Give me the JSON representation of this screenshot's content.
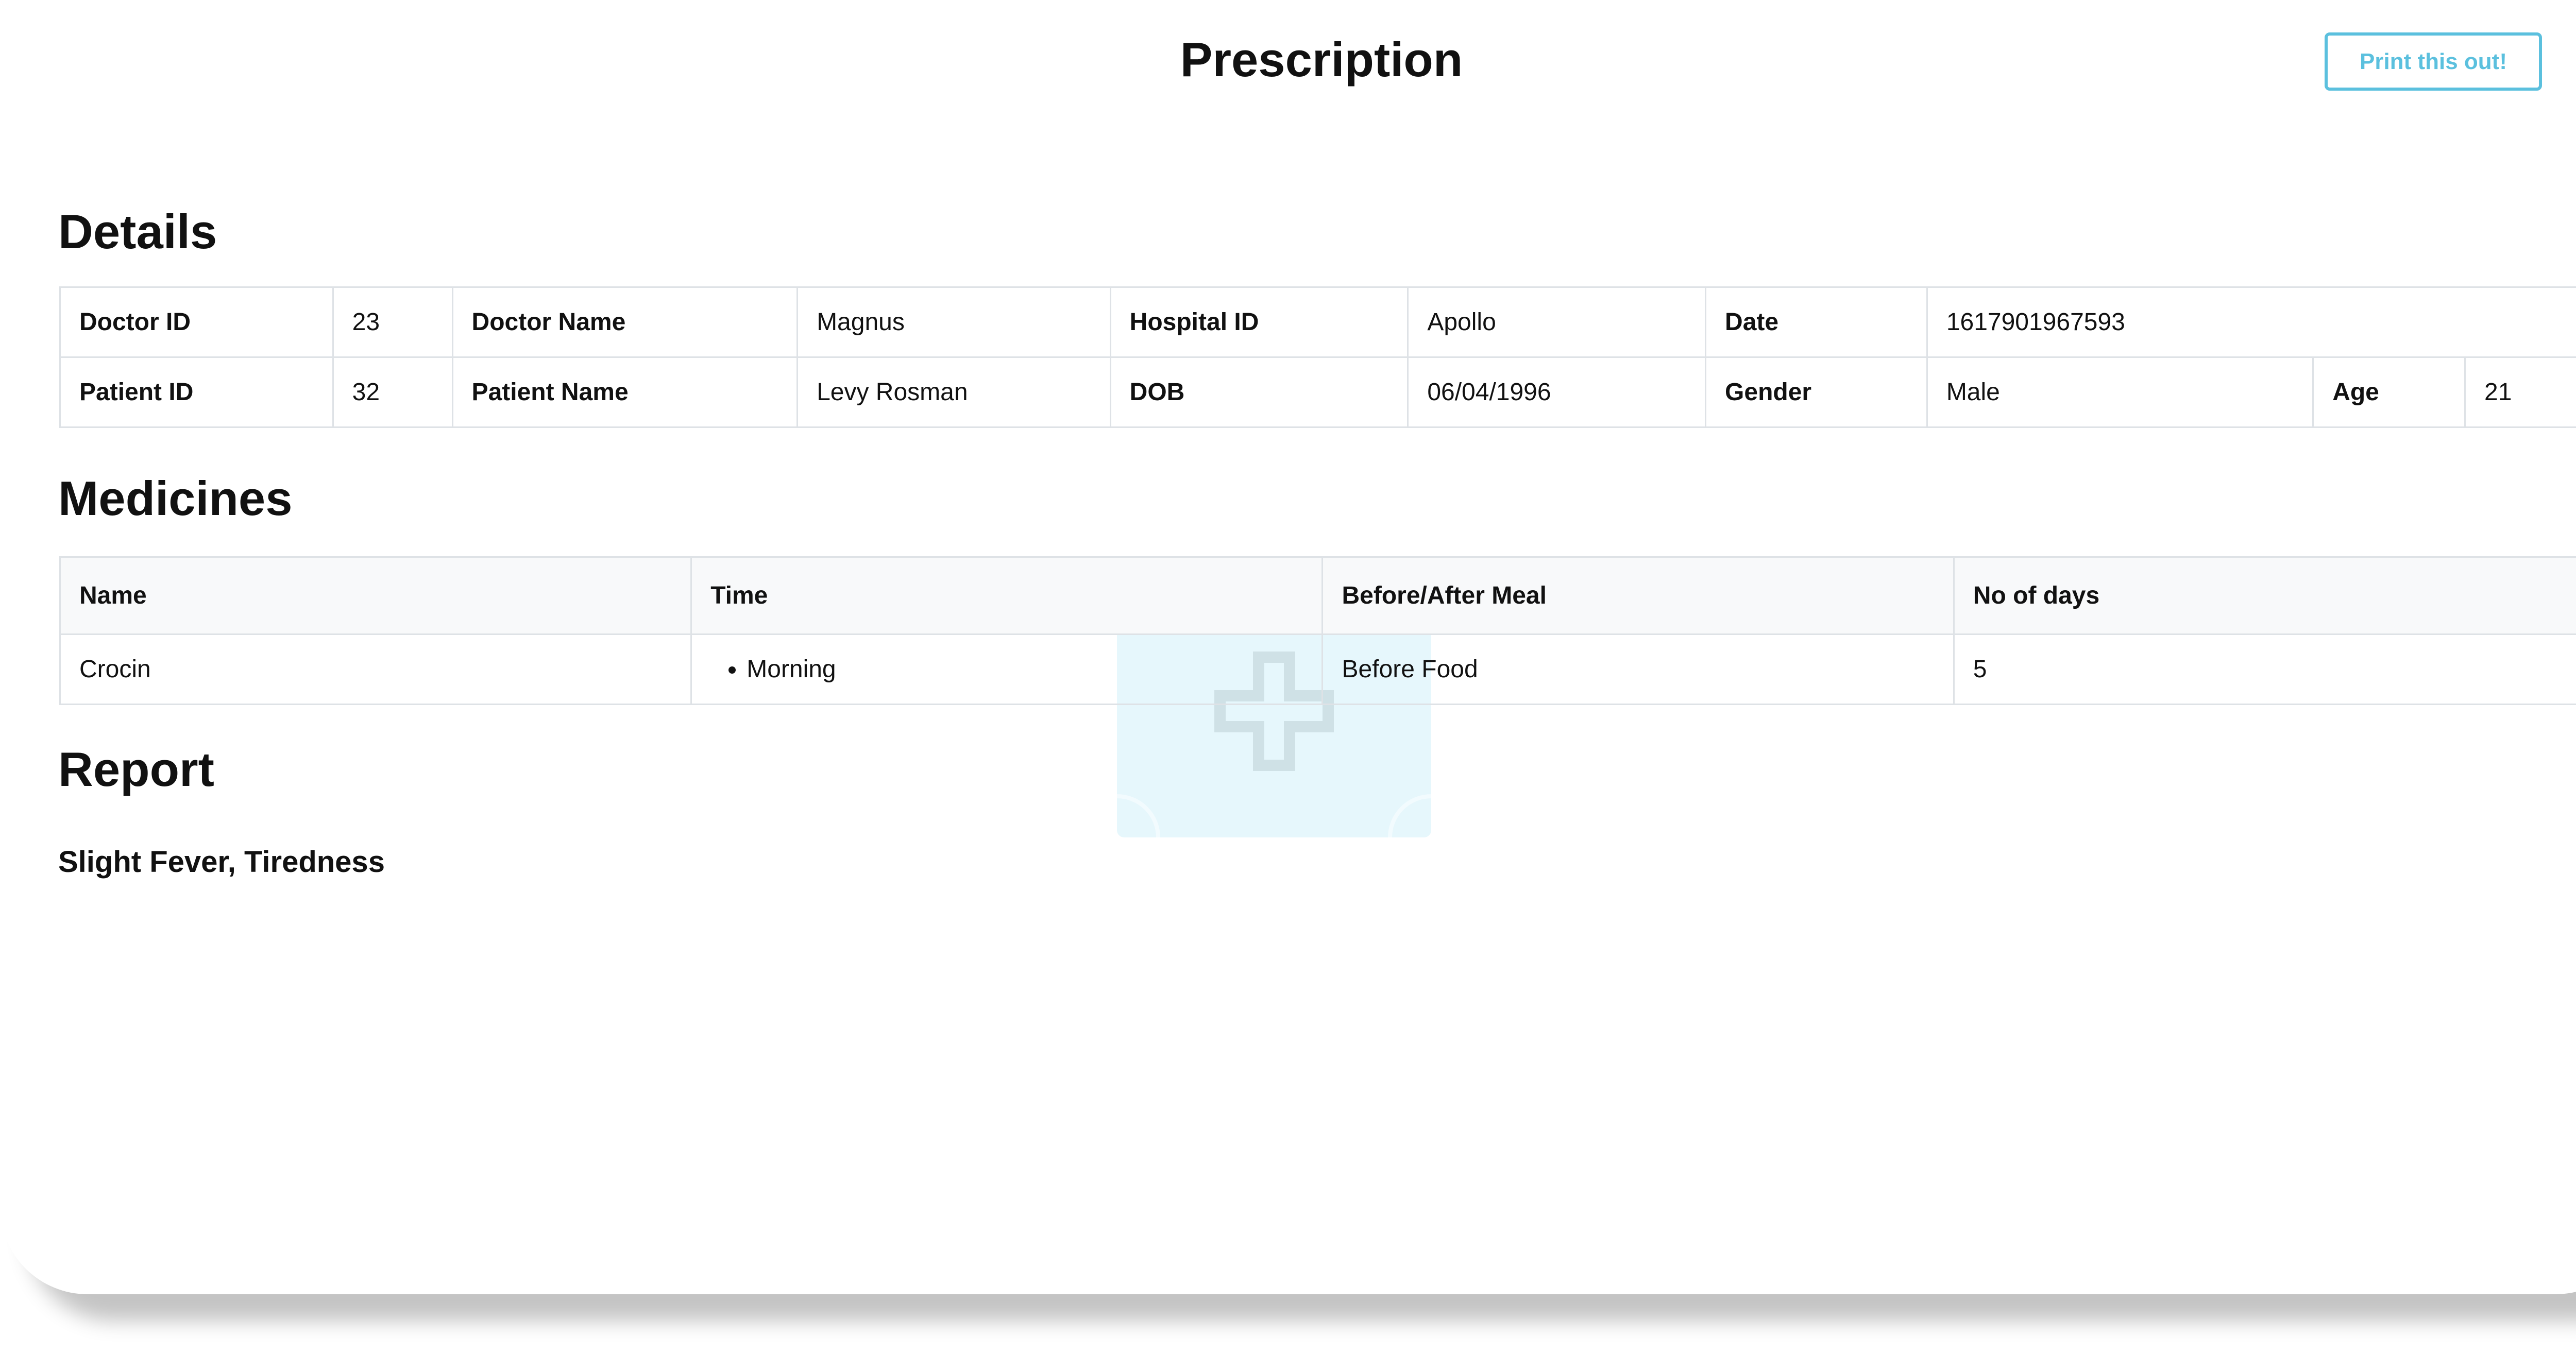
{
  "page": {
    "title": "Prescription"
  },
  "toolbar": {
    "print_label": "Print this out!"
  },
  "details": {
    "heading": "Details",
    "row1": {
      "doctor_id_label": "Doctor ID",
      "doctor_id": "23",
      "doctor_name_label": "Doctor Name",
      "doctor_name": "Magnus",
      "hospital_id_label": "Hospital ID",
      "hospital_id": "Apollo",
      "date_label": "Date",
      "date": "1617901967593"
    },
    "row2": {
      "patient_id_label": "Patient ID",
      "patient_id": "32",
      "patient_name_label": "Patient Name",
      "patient_name": "Levy Rosman",
      "dob_label": "DOB",
      "dob": "06/04/1996",
      "gender_label": "Gender",
      "gender": "Male",
      "age_label": "Age",
      "age": "21"
    }
  },
  "medicines": {
    "heading": "Medicines",
    "columns": [
      "Name",
      "Time",
      "Before/After Meal",
      "No of days"
    ],
    "rows": [
      {
        "name": "Crocin",
        "times": [
          "Morning"
        ],
        "meal": "Before Food",
        "days": "5"
      }
    ]
  },
  "report": {
    "heading": "Report",
    "text": "Slight Fever, Tiredness"
  },
  "colors": {
    "accent": "#5bc0de",
    "border": "#dee2e6",
    "header_bg": "#f8f9fa",
    "watermark": "#e6f7fc"
  },
  "icons": {
    "watermark": "medical-kit-icon"
  }
}
